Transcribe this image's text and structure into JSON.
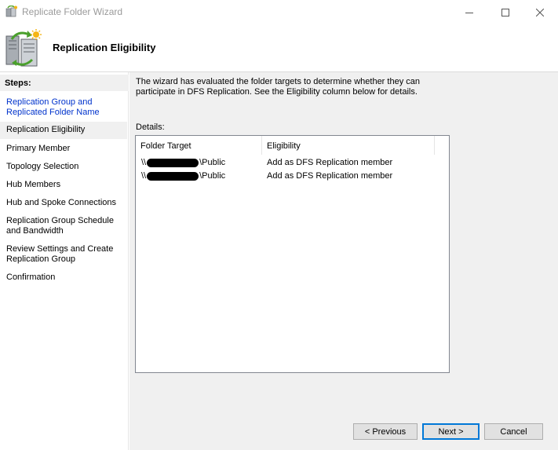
{
  "window": {
    "title": "Replicate Folder Wizard",
    "controls": {
      "minimize": "minimize",
      "maximize": "maximize",
      "close": "close"
    }
  },
  "header": {
    "title": "Replication Eligibility",
    "icon": "dfs-replication-icon"
  },
  "sidebar": {
    "heading": "Steps:",
    "items": [
      {
        "label": "Replication Group and Replicated Folder Name",
        "state": "link"
      },
      {
        "label": "Replication Eligibility",
        "state": "current"
      },
      {
        "label": "Primary Member",
        "state": "pending"
      },
      {
        "label": "Topology Selection",
        "state": "pending"
      },
      {
        "label": "Hub Members",
        "state": "pending"
      },
      {
        "label": "Hub and Spoke Connections",
        "state": "pending"
      },
      {
        "label": "Replication Group Schedule and Bandwidth",
        "state": "pending"
      },
      {
        "label": "Review Settings and Create Replication Group",
        "state": "pending"
      },
      {
        "label": "Confirmation",
        "state": "pending"
      }
    ]
  },
  "main": {
    "description": "The wizard has evaluated the folder targets to determine whether they can participate in DFS Replication. See the Eligibility column below for details.",
    "details_label": "Details:",
    "table": {
      "columns": [
        "Folder Target",
        "Eligibility"
      ],
      "rows": [
        {
          "prefix": "\\\\",
          "suffix": "\\Public",
          "eligibility": "Add as DFS Replication member"
        },
        {
          "prefix": "\\\\",
          "suffix": "\\Public",
          "eligibility": "Add as DFS Replication member"
        }
      ]
    }
  },
  "buttons": {
    "previous": "< Previous",
    "next": "Next >",
    "cancel": "Cancel"
  },
  "colors": {
    "link": "#0033cc",
    "panel_bg": "#f0f0f0",
    "default_button_border": "#0078d7"
  }
}
